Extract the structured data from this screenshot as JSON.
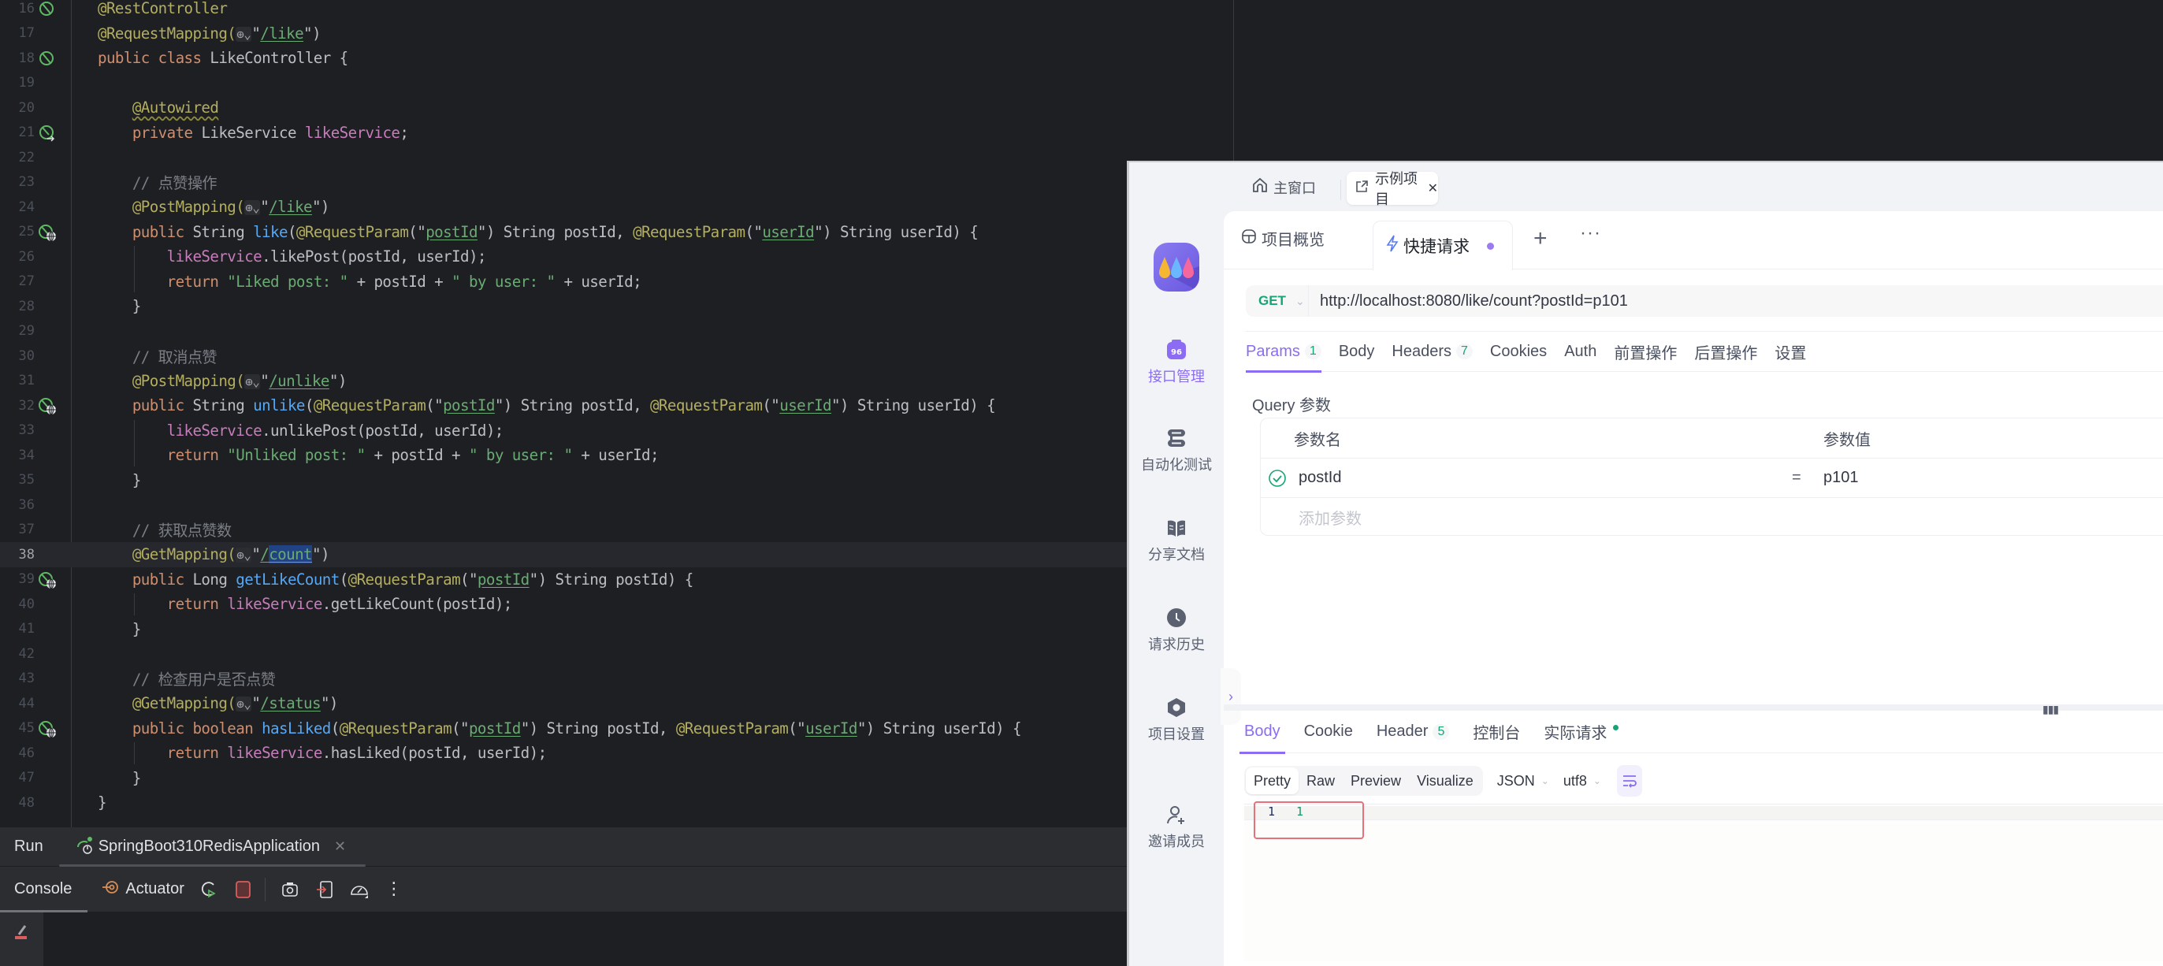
{
  "editor": {
    "current_line": 38,
    "lines": [
      {
        "n": 16,
        "gutter": "spring-bean-icon"
      },
      {
        "n": 17
      },
      {
        "n": 18,
        "gutter": "spring-bean-icon"
      },
      {
        "n": 19
      },
      {
        "n": 20
      },
      {
        "n": 21,
        "gutter": "spring-autowire-icon"
      },
      {
        "n": 22
      },
      {
        "n": 23
      },
      {
        "n": 24
      },
      {
        "n": 25,
        "gutter": "endpoint-globe-icon"
      },
      {
        "n": 26
      },
      {
        "n": 27
      },
      {
        "n": 28
      },
      {
        "n": 29
      },
      {
        "n": 30
      },
      {
        "n": 31
      },
      {
        "n": 32,
        "gutter": "endpoint-globe-icon"
      },
      {
        "n": 33
      },
      {
        "n": 34
      },
      {
        "n": 35
      },
      {
        "n": 36
      },
      {
        "n": 37
      },
      {
        "n": 38
      },
      {
        "n": 39,
        "gutter": "endpoint-globe-icon"
      },
      {
        "n": 40
      },
      {
        "n": 41
      },
      {
        "n": 42
      },
      {
        "n": 43
      },
      {
        "n": 44
      },
      {
        "n": 45,
        "gutter": "endpoint-globe-icon"
      },
      {
        "n": 46
      },
      {
        "n": 47
      },
      {
        "n": 48
      }
    ],
    "code": {
      "l16": "@RestController",
      "l17_a": "@RequestMapping(",
      "l17_path": "/like",
      "l18_kw": "public class ",
      "l18_rest": "LikeController {",
      "l20": "@Autowired",
      "l21_kw": "private ",
      "l21_type": "LikeService ",
      "l21_fld": "likeService",
      "l23": "// 点赞操作",
      "l24_a": "@PostMapping(",
      "l24_path": "/like",
      "l25_fn": "like",
      "l26_call": ".likePost(postId, userId);",
      "l27_str1": "\"Liked post: \"",
      "l27_str2": "\" by user: \"",
      "l30": "// 取消点赞",
      "l31_a": "@PostMapping(",
      "l31_path": "/unlike",
      "l32_fn": "unlike",
      "l33_call": ".unlikePost(postId, userId);",
      "l34_str1": "\"Unliked post: \"",
      "l34_str2": "\" by user: \"",
      "l37": "// 获取点赞数",
      "l38_a": "@GetMapping(",
      "l38_path_slash": "/",
      "l38_path_sel": "count",
      "l39_type": "Long ",
      "l39_fn": "getLikeCount",
      "l40_call": ".getLikeCount(postId);",
      "l43": "// 检查用户是否点赞",
      "l44_a": "@GetMapping(",
      "l44_path": "/status",
      "l45_type": "boolean ",
      "l45_fn": "hasLiked",
      "l46_call": ".hasLiked(postId, userId);",
      "public": "public ",
      "string_type": "String ",
      "return": "return ",
      "request_param": "@RequestParam",
      "post_id_param": "postId",
      "user_id_param": "userId",
      "like_service": "likeService"
    }
  },
  "run_window": {
    "title": "Run",
    "app_tab": "SpringBoot310RedisApplication",
    "console_tab": "Console",
    "actuator_tab": "Actuator"
  },
  "apifox": {
    "home_tab": "主窗口",
    "project_tab": "示例项目",
    "sidebar": [
      {
        "label": "接口管理",
        "icon": "api-management-icon",
        "active": true
      },
      {
        "label": "自动化测试",
        "icon": "automation-test-icon"
      },
      {
        "label": "分享文档",
        "icon": "share-docs-icon"
      },
      {
        "label": "请求历史",
        "icon": "history-clock-icon"
      },
      {
        "label": "项目设置",
        "icon": "settings-hex-icon"
      },
      {
        "label": "邀请成员",
        "icon": "invite-member-icon"
      }
    ],
    "tabs": {
      "overview": "项目概览",
      "quick_request": "快捷请求",
      "plus": "+",
      "more": "···"
    },
    "request": {
      "method": "GET",
      "url": "http://localhost:8080/like/count?postId=p101"
    },
    "request_tabs": [
      {
        "label": "Params",
        "badge": "1",
        "active": true
      },
      {
        "label": "Body"
      },
      {
        "label": "Headers",
        "badge": "7"
      },
      {
        "label": "Cookies"
      },
      {
        "label": "Auth"
      },
      {
        "label": "前置操作"
      },
      {
        "label": "后置操作"
      },
      {
        "label": "设置"
      }
    ],
    "query": {
      "label": "Query 参数",
      "col_name": "参数名",
      "col_value": "参数值",
      "rows": [
        {
          "name": "postId",
          "eq": "=",
          "value": "p101",
          "enabled": true
        }
      ],
      "add_placeholder": "添加参数"
    },
    "response_tabs": [
      {
        "label": "Body",
        "active": true
      },
      {
        "label": "Cookie"
      },
      {
        "label": "Header",
        "badge": "5"
      },
      {
        "label": "控制台"
      },
      {
        "label": "实际请求",
        "dot": true
      }
    ],
    "view_modes": [
      "Pretty",
      "Raw",
      "Preview",
      "Visualize"
    ],
    "active_view": "Pretty",
    "format": "JSON",
    "encoding": "utf8",
    "response_body": {
      "line": "1",
      "value": "1"
    }
  },
  "colors": {
    "accent": "#8b6cf2",
    "success": "#17a673",
    "highlight_box": "#e8707a"
  }
}
